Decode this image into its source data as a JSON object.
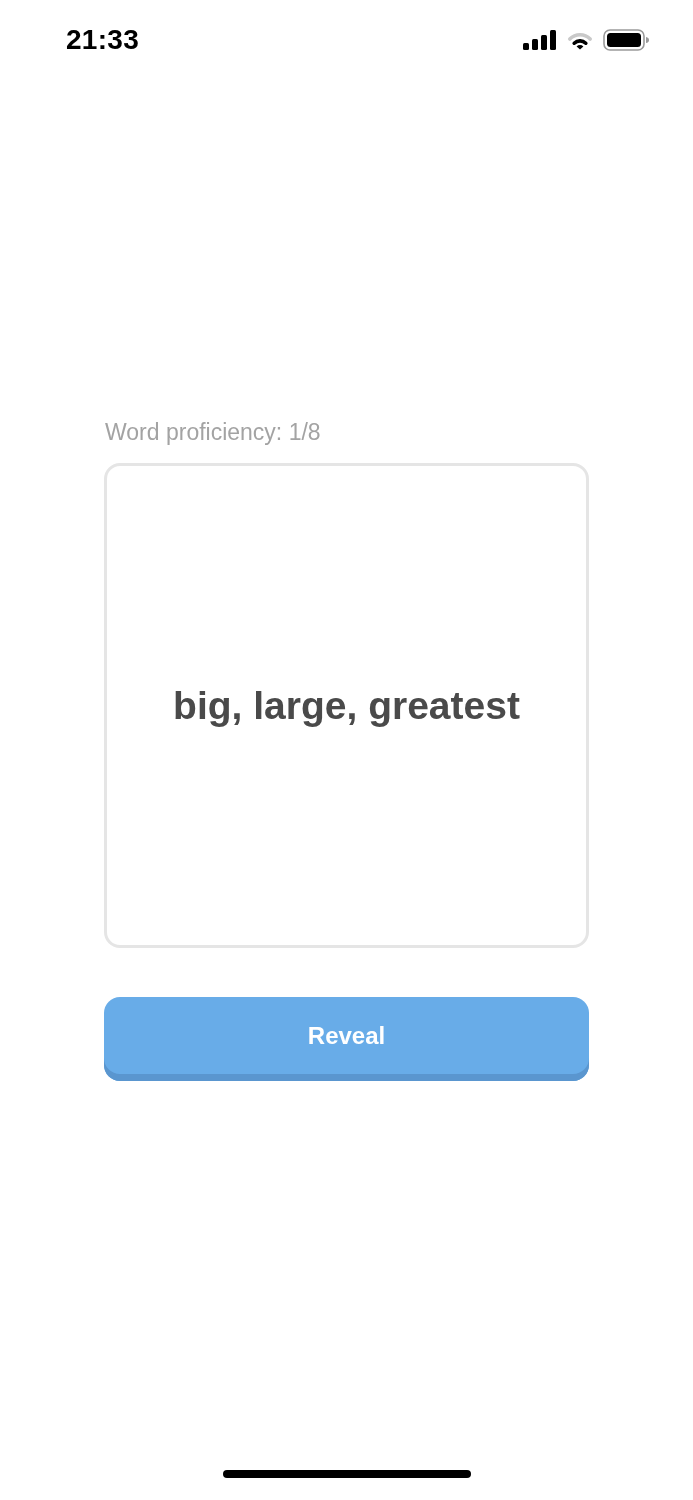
{
  "status_bar": {
    "time": "21:33"
  },
  "proficiency": "Word proficiency: 1/8",
  "card": {
    "text": "big, large, greatest"
  },
  "button": {
    "label": "Reveal"
  }
}
